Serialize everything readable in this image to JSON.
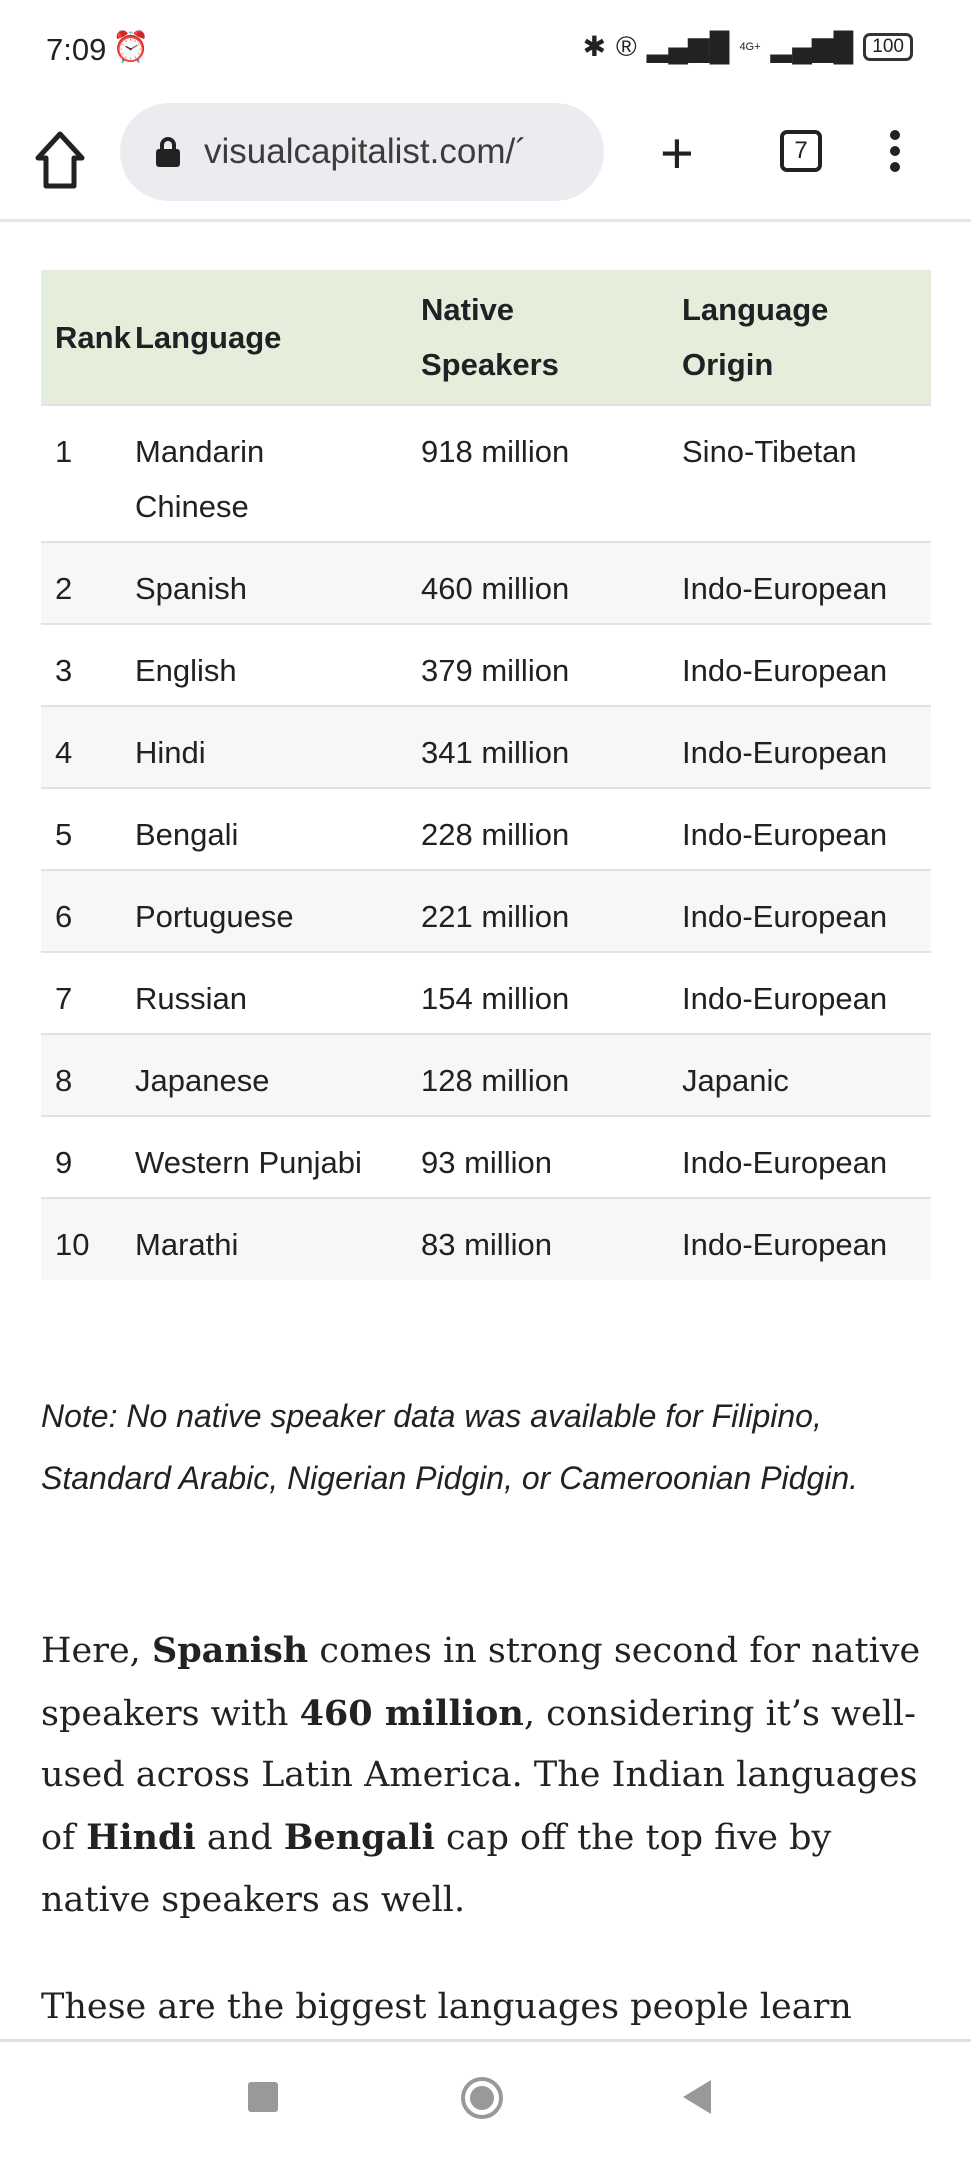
{
  "status_bar": {
    "time": "7:09",
    "battery": "100",
    "network": "4G+"
  },
  "browser": {
    "url": "visualcapitalist.com/´",
    "tab_count": "7"
  },
  "table": {
    "headers": [
      "Rank",
      "Language",
      "Native Speakers",
      "Language Origin"
    ],
    "rows": [
      [
        "1",
        "Mandarin Chinese",
        "918 million",
        "Sino-Tibetan"
      ],
      [
        "2",
        "Spanish",
        "460 million",
        "Indo-European"
      ],
      [
        "3",
        "English",
        "379 million",
        "Indo-European"
      ],
      [
        "4",
        "Hindi",
        "341 million",
        "Indo-European"
      ],
      [
        "5",
        "Bengali",
        "228 million",
        "Indo-European"
      ],
      [
        "6",
        "Portuguese",
        "221 million",
        "Indo-European"
      ],
      [
        "7",
        "Russian",
        "154 million",
        "Indo-European"
      ],
      [
        "8",
        "Japanese",
        "128 million",
        "Japanic"
      ],
      [
        "9",
        "Western Punjabi",
        "93 million",
        "Indo-European"
      ],
      [
        "10",
        "Marathi",
        "83 million",
        "Indo-European"
      ]
    ]
  },
  "note": "Note: No native speaker data was available for Filipino, Standard Arabic, Nigerian Pidgin, or Cameroonian Pidgin.",
  "paragraph1": {
    "s0": "Here, ",
    "b0": "Spanish",
    "s1": " comes in strong second for native speakers with ",
    "b1": "460 million",
    "s2": ", considering it’s well-used across Latin America. The Indian languages of ",
    "b2": "Hindi",
    "s3": " and ",
    "b3": "Bengali",
    "s4": " cap off the top five by native speakers as well."
  },
  "paragraph2": "These are the biggest languages people learn"
}
